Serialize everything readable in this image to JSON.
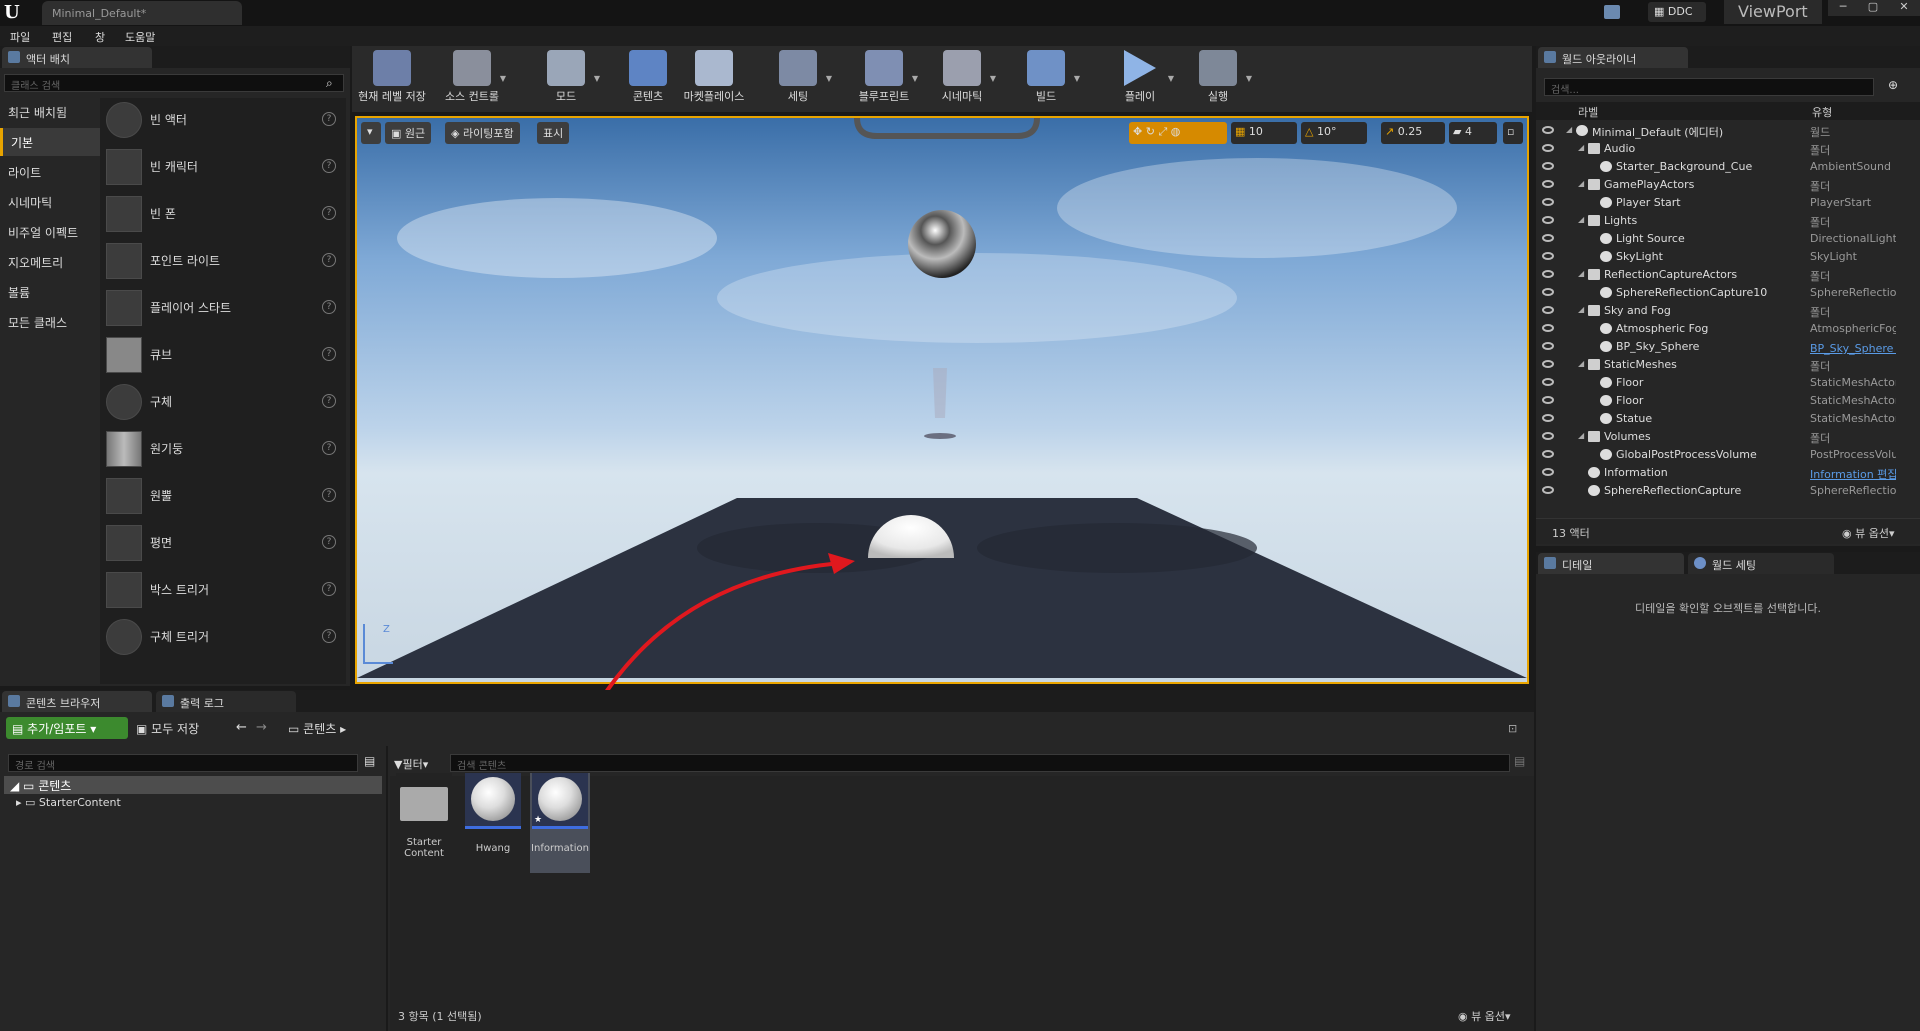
{
  "window": {
    "tab_title": "Minimal_Default*",
    "ddc_label": "DDC",
    "brand_text": "ViewPort"
  },
  "menu": [
    "파일",
    "편집",
    "창",
    "도움말"
  ],
  "place_actors": {
    "tab_label": "액터 배치",
    "search_placeholder": "클래스 검색",
    "categories": [
      "최근 배치됨",
      "기본",
      "라이트",
      "시네마틱",
      "비주얼 이펙트",
      "지오메트리",
      "볼륨",
      "모든 클래스"
    ],
    "selected_category": "기본",
    "items": [
      "빈 액터",
      "빈 캐릭터",
      "빈 폰",
      "포인트 라이트",
      "플레이어 스타트",
      "큐브",
      "구체",
      "원기둥",
      "원뿔",
      "평면",
      "박스 트리거",
      "구체 트리거"
    ]
  },
  "toolbar": [
    "현재 레벨 저장",
    "소스 컨트롤",
    "모드",
    "콘텐츠",
    "마켓플레이스",
    "세팅",
    "블루프린트",
    "시네마틱",
    "빌드",
    "플레이",
    "실행"
  ],
  "viewport": {
    "buttons": [
      "원근",
      "라이팅포함",
      "표시"
    ],
    "grid_snap": "10",
    "rotation_snap": "10°",
    "scale_snap": "0.25",
    "camera_speed": "4"
  },
  "outliner": {
    "tab_label": "월드 아웃라이너",
    "search_placeholder": "검색...",
    "col_label": "라벨",
    "col_type": "유형",
    "rows": [
      {
        "name": "Minimal_Default (에디터)",
        "type": "월드",
        "indent": 0
      },
      {
        "name": "Audio",
        "type": "폴더",
        "indent": 1
      },
      {
        "name": "Starter_Background_Cue",
        "type": "AmbientSound",
        "indent": 2
      },
      {
        "name": "GamePlayActors",
        "type": "폴더",
        "indent": 1
      },
      {
        "name": "Player Start",
        "type": "PlayerStart",
        "indent": 2
      },
      {
        "name": "Lights",
        "type": "폴더",
        "indent": 1
      },
      {
        "name": "Light Source",
        "type": "DirectionalLight",
        "indent": 2
      },
      {
        "name": "SkyLight",
        "type": "SkyLight",
        "indent": 2
      },
      {
        "name": "ReflectionCaptureActors",
        "type": "폴더",
        "indent": 1
      },
      {
        "name": "SphereReflectionCapture10",
        "type": "SphereReflectionC",
        "indent": 2
      },
      {
        "name": "Sky and Fog",
        "type": "폴더",
        "indent": 1
      },
      {
        "name": "Atmospheric Fog",
        "type": "AtmosphericFog",
        "indent": 2
      },
      {
        "name": "BP_Sky_Sphere",
        "type": "BP_Sky_Sphere 편",
        "indent": 2
      },
      {
        "name": "StaticMeshes",
        "type": "폴더",
        "indent": 1
      },
      {
        "name": "Floor",
        "type": "StaticMeshActor",
        "indent": 2
      },
      {
        "name": "Floor",
        "type": "StaticMeshActor",
        "indent": 2
      },
      {
        "name": "Statue",
        "type": "StaticMeshActor",
        "indent": 2
      },
      {
        "name": "Volumes",
        "type": "폴더",
        "indent": 1
      },
      {
        "name": "GlobalPostProcessVolume",
        "type": "PostProcessVolun",
        "indent": 2
      },
      {
        "name": "Information",
        "type": "Information 편집",
        "indent": 1
      },
      {
        "name": "SphereReflectionCapture",
        "type": "SphereReflectionC",
        "indent": 1
      }
    ],
    "count": "13 액터",
    "view_options": "뷰 옵션"
  },
  "details": {
    "tab_details": "디테일",
    "tab_world": "월드 세팅",
    "empty_msg": "디테일을 확인할 오브젝트를 선택합니다."
  },
  "content_browser": {
    "tab_label": "콘텐츠 브라우저",
    "tab_output": "출력 로그",
    "add_import": "추가/임포트",
    "save_all": "모두 저장",
    "path": "콘텐츠",
    "path_search": "경로 검색",
    "tree_root": "콘텐츠",
    "tree_child": "StarterContent",
    "filter_label": "필터",
    "search_placeholder": "검색 콘텐츠",
    "assets": [
      {
        "label_line1": "Starter",
        "label_line2": "Content"
      },
      {
        "label_line1": "Hwang",
        "label_line2": ""
      },
      {
        "label_line1": "Information",
        "label_line2": ""
      }
    ],
    "status": "3 항목 (1 선택됨)",
    "view_options": "뷰 옵션"
  },
  "colors": {
    "accent": "#e8a400",
    "selection": "#3e6de0",
    "annotation": "#e0181e",
    "add_button": "#3c8a2e"
  }
}
